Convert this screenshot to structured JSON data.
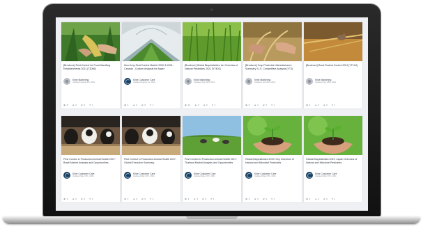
{
  "cards": [
    {
      "title": "[Brochure] Pest Control for Food Handling Establishments 2021 [T3006]",
      "author": "Kline Marketing",
      "date": "Updated August 5th, 2021",
      "avatar": "person",
      "thumb": "corn",
      "stats": [
        "8",
        "0",
        "0",
        "1"
      ]
    },
    {
      "title": "Non-Crop Pest Control Market 2020 & 2021: Canada - Custom Analysis for Bayer",
      "author": "Kline Customer Care",
      "date": "Updated August 1st, 2021",
      "avatar": "kline",
      "thumb": "greenhouse",
      "stats": [
        "6",
        "0",
        "0",
        "1"
      ]
    },
    {
      "title": "[Brochure] Global Biopesticides: An Overview of Natural Pesticides 2021 [YT402]",
      "author": "Kline Marketing",
      "date": "Updated July 30th, 2021",
      "avatar": "person",
      "thumb": "grass",
      "stats": [
        "13",
        "0",
        "0",
        "1"
      ]
    },
    {
      "title": "[Brochure] Crop Protection Manufacturers Summary: U.S. Competitive Analysis [YT1]",
      "author": "Kline Marketing",
      "date": "Updated July 28th, 2021",
      "avatar": "person",
      "thumb": "wheat-hands",
      "stats": [
        "5",
        "0",
        "0",
        "1"
      ]
    },
    {
      "title": "[Brochure] Rural Rodent Control 2021 [YT104]",
      "author": "Kline Marketing",
      "date": "Updated July 28th, 2021",
      "avatar": "person",
      "thumb": "mouse",
      "stats": [
        "6",
        "0",
        "0",
        "1"
      ]
    },
    {
      "title": "Pest Control in Production Animal Health 2017: Brazil Market Analysis and Opportunities",
      "author": "Kline Customer Care",
      "date": "Updated May 27th, 2021",
      "avatar": "kline",
      "thumb": "cows",
      "stats": [
        "3",
        "0",
        "0",
        "1"
      ]
    },
    {
      "title": "Pest Control in Production Animal Health 2017: Global Executive Summary",
      "author": "Kline Customer Care",
      "date": "Updated May 27th, 2021",
      "avatar": "kline",
      "thumb": "cows",
      "stats": [
        "3",
        "0",
        "0",
        "1"
      ]
    },
    {
      "title": "Pest Control in Production Animal Health 2017: Thailand Market Analysis and Opportunities",
      "author": "Kline Customer Care",
      "date": "Updated May 27th, 2021",
      "avatar": "kline",
      "thumb": "pasture",
      "stats": [
        "3",
        "0",
        "0",
        "1"
      ]
    },
    {
      "title": "Global Biopesticides 2019: Key Overview of Natural and Microbial Pesticides",
      "author": "Kline Customer Care",
      "date": "Updated May 27th, 2021",
      "avatar": "kline",
      "thumb": "seedling",
      "stats": [
        "3",
        "0",
        "0",
        "1"
      ]
    },
    {
      "title": "Global Biopesticides 2019: Japan Overview of Natural and Microbial Pesticides",
      "author": "Kline Customer Care",
      "date": "Updated May 27th, 2021",
      "avatar": "kline",
      "thumb": "seedling",
      "stats": [
        "3",
        "0",
        "0",
        "1"
      ]
    }
  ],
  "icons": {
    "views": "eye-icon",
    "likes": "thumbs-up-icon",
    "comments": "comment-icon",
    "users": "user-icon"
  },
  "colors": {
    "grass": "#4f9a2c",
    "sky": "#9fc3dc",
    "kline": "#1d3f5e"
  }
}
